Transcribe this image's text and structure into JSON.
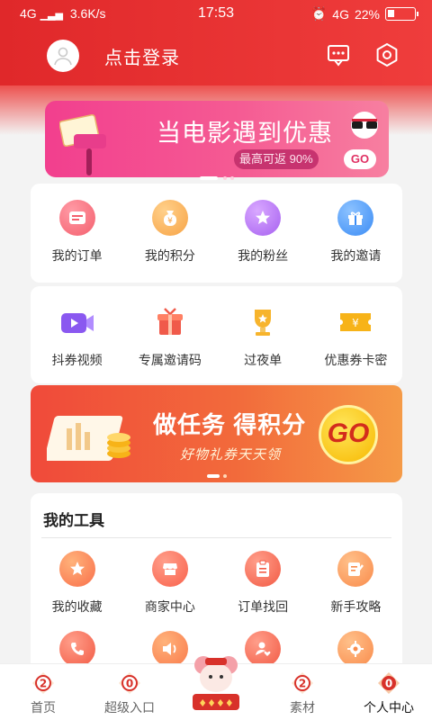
{
  "status_bar": {
    "network": "4G",
    "speed": "3.6K/s",
    "time": "17:53",
    "right_network": "4G",
    "battery": "22%"
  },
  "header": {
    "login_label": "点击登录",
    "icons": [
      "message-icon",
      "settings-icon"
    ]
  },
  "banner_top": {
    "title": "当电影遇到优惠",
    "subtitle": "最高可返 90%",
    "go": "GO"
  },
  "grid1": [
    {
      "label": "我的订单",
      "icon": "order-icon",
      "color": "#f4606e"
    },
    {
      "label": "我的积分",
      "icon": "points-bag-icon",
      "color": "#f7a345"
    },
    {
      "label": "我的粉丝",
      "icon": "star-icon",
      "color": "#a660f0"
    },
    {
      "label": "我的邀请",
      "icon": "gift-icon",
      "color": "#3b8cf5"
    }
  ],
  "grid2": [
    {
      "label": "抖券视频",
      "icon": "video-icon",
      "color": "#8a58f0"
    },
    {
      "label": "专属邀请码",
      "icon": "gift-box-icon",
      "color": "#f05a4a"
    },
    {
      "label": "过夜单",
      "icon": "trophy-icon",
      "color": "#f7b42c"
    },
    {
      "label": "优惠券卡密",
      "icon": "coupon-icon",
      "color": "#f7b318"
    }
  ],
  "banner_task": {
    "title": "做任务 得积分",
    "subtitle": "好物礼券天天领",
    "go": "GO"
  },
  "tools": {
    "title": "我的工具",
    "row1": [
      {
        "label": "我的收藏",
        "icon": "favorite-star-icon",
        "color": "#f96f4b"
      },
      {
        "label": "商家中心",
        "icon": "shop-icon",
        "color": "#f96f4b"
      },
      {
        "label": "订单找回",
        "icon": "clipboard-icon",
        "color": "#f96f4b"
      },
      {
        "label": "新手攻略",
        "icon": "edit-note-icon",
        "color": "#f96f4b"
      }
    ],
    "row2": [
      {
        "icon": "phone-icon",
        "color": "#f96f4b"
      },
      {
        "icon": "speaker-icon",
        "color": "#f96f4b"
      },
      {
        "icon": "user-heart-icon",
        "color": "#f96f4b"
      },
      {
        "icon": "gear-icon",
        "color": "#f96f4b"
      }
    ]
  },
  "bottom_nav": [
    {
      "label": "首页",
      "active": false
    },
    {
      "label": "超级入口",
      "active": false
    },
    {
      "label": "",
      "active": false,
      "icon": "lucky-mascot-icon"
    },
    {
      "label": "素材",
      "active": false
    },
    {
      "label": "个人中心",
      "active": true
    }
  ],
  "colors": {
    "header_red": "#e5302c",
    "accent_red": "#d8312a"
  }
}
